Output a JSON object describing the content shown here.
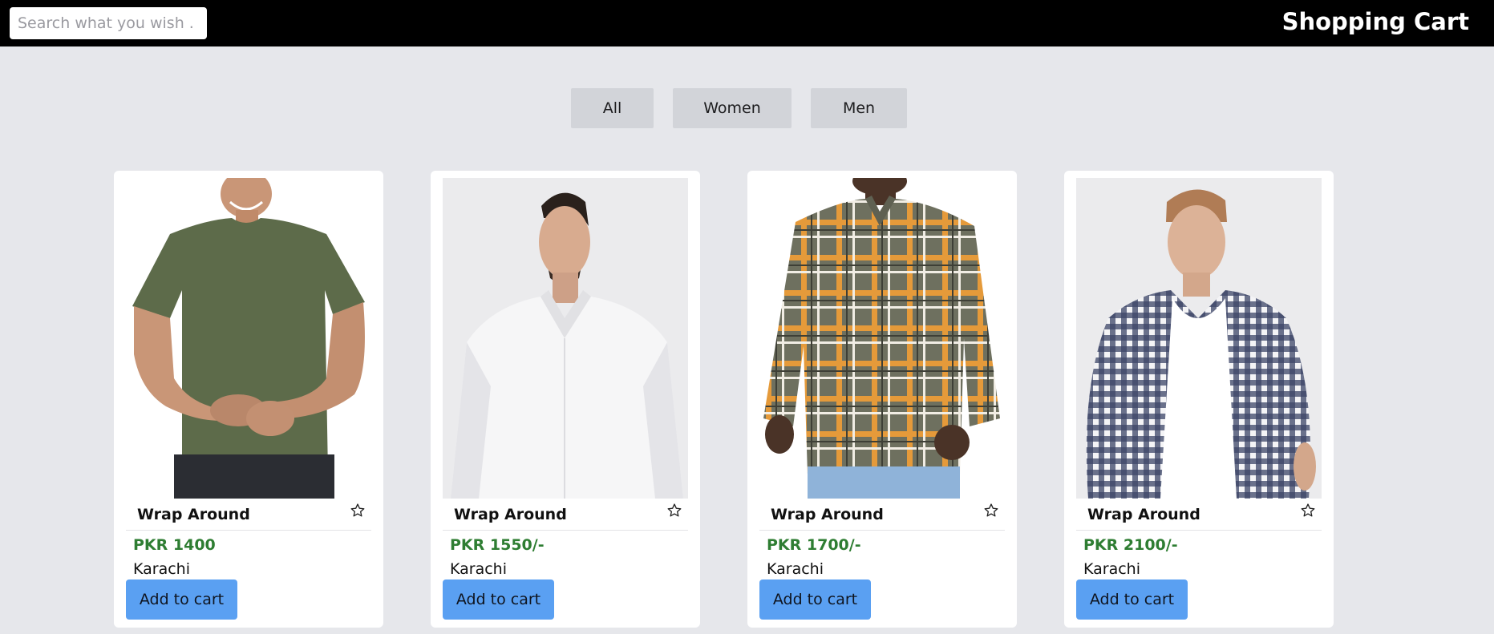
{
  "header": {
    "search_placeholder": "Search what you wish . . .",
    "title": "Shopping Cart"
  },
  "filters": [
    "All",
    "Women",
    "Men"
  ],
  "products": [
    {
      "name": "Wrap Around",
      "price": "PKR 1400",
      "city": "Karachi",
      "cart_label": "Add to cart",
      "image": "green-tshirt",
      "favorite_icon": "star-outline-icon"
    },
    {
      "name": "Wrap Around",
      "price": "PKR 1550/-",
      "city": "Karachi",
      "cart_label": "Add to cart",
      "image": "white-shirt",
      "favorite_icon": "star-outline-icon"
    },
    {
      "name": "Wrap Around",
      "price": "PKR 1700/-",
      "city": "Karachi",
      "cart_label": "Add to cart",
      "image": "plaid-shirt",
      "favorite_icon": "star-outline-icon"
    },
    {
      "name": "Wrap Around",
      "price": "PKR 2100/-",
      "city": "Karachi",
      "cart_label": "Add to cart",
      "image": "checked-shirt",
      "favorite_icon": "star-outline-icon"
    }
  ],
  "colors": {
    "header_bg": "#000000",
    "page_bg": "#e6e7eb",
    "filter_bg": "#d2d4d9",
    "price": "#2e7d32",
    "cart_button": "#5aa0f2"
  }
}
